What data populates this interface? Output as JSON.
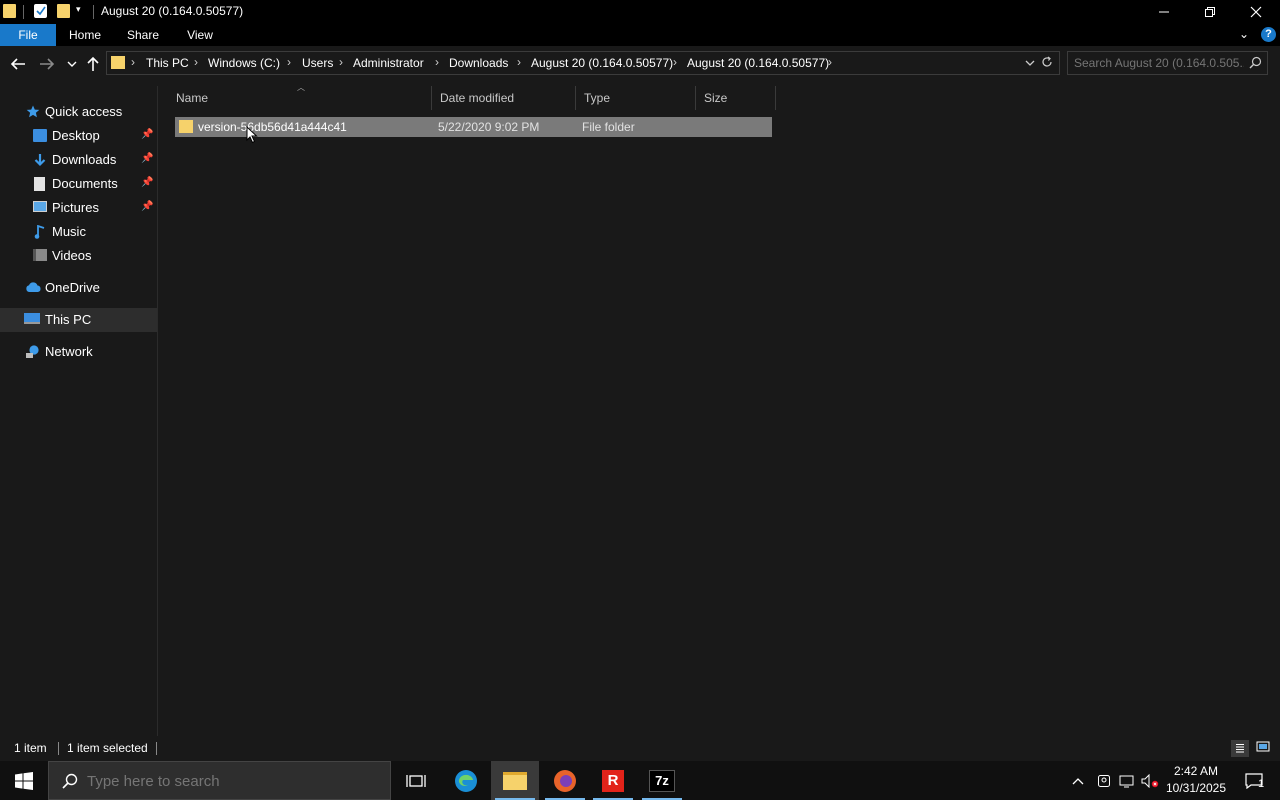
{
  "window": {
    "title": "August 20 (0.164.0.50577)"
  },
  "ribbon": {
    "tabs": [
      "File",
      "Home",
      "Share",
      "View"
    ]
  },
  "address": {
    "crumbs": [
      "This PC",
      "Windows (C:)",
      "Users",
      "Administrator",
      "Downloads",
      "August 20 (0.164.0.50577)",
      "August 20 (0.164.0.50577)"
    ]
  },
  "search": {
    "placeholder": "Search August 20 (0.164.0.505..."
  },
  "nav": {
    "quick_access": "Quick access",
    "items": [
      "Desktop",
      "Downloads",
      "Documents",
      "Pictures",
      "Music",
      "Videos"
    ],
    "onedrive": "OneDrive",
    "thispc": "This PC",
    "network": "Network"
  },
  "columns": {
    "name": "Name",
    "date": "Date modified",
    "type": "Type",
    "size": "Size"
  },
  "files": [
    {
      "name": "version-56db56d41a444c41",
      "date": "5/22/2020 9:02 PM",
      "type": "File folder",
      "size": ""
    }
  ],
  "status": {
    "count": "1 item",
    "selected": "1 item selected"
  },
  "taskbar": {
    "search_placeholder": "Type here to search",
    "time": "2:42 AM",
    "date": "10/31/2025",
    "notification_count": "1"
  },
  "colors": {
    "accent": "#1979ca",
    "folder": "#f6d26b",
    "selection": "#7a7a7a"
  }
}
